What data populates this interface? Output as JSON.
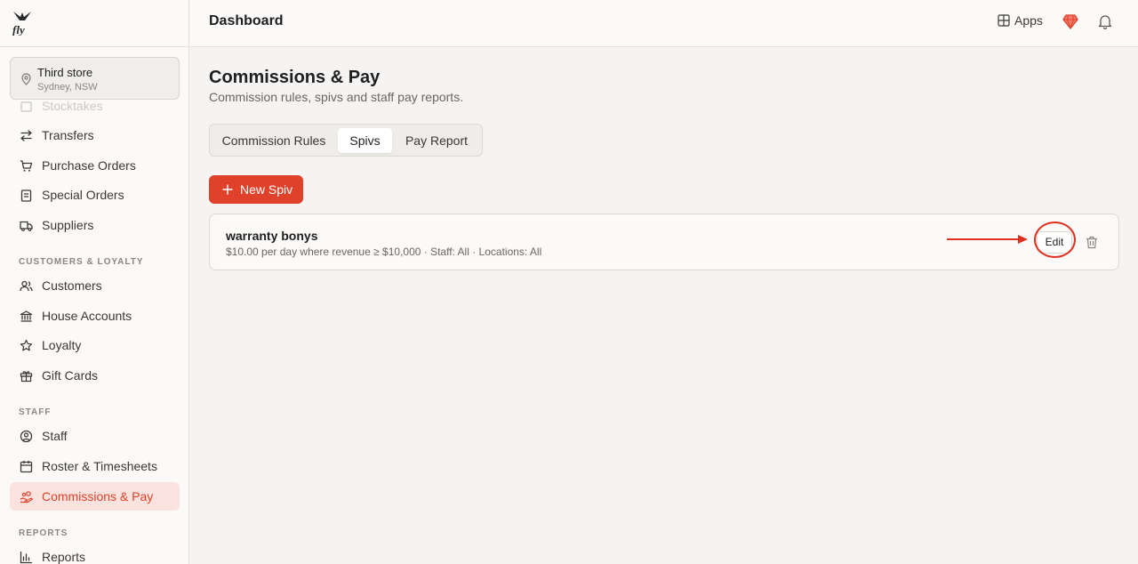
{
  "colors": {
    "accent": "#e0412b",
    "annotation": "#e0301e"
  },
  "store": {
    "name": "Third store",
    "location": "Sydney, NSW"
  },
  "sidebar": {
    "partial_item": "Stocktakes",
    "items_top": [
      {
        "label": "Transfers",
        "icon": "transfer-arrows-icon"
      },
      {
        "label": "Purchase Orders",
        "icon": "cart-icon"
      },
      {
        "label": "Special Orders",
        "icon": "clipboard-icon"
      },
      {
        "label": "Suppliers",
        "icon": "truck-icon"
      }
    ],
    "section_customers": "CUSTOMERS & LOYALTY",
    "items_customers": [
      {
        "label": "Customers",
        "icon": "users-icon"
      },
      {
        "label": "House Accounts",
        "icon": "bank-icon"
      },
      {
        "label": "Loyalty",
        "icon": "star-icon"
      },
      {
        "label": "Gift Cards",
        "icon": "gift-icon"
      }
    ],
    "section_staff": "STAFF",
    "items_staff": [
      {
        "label": "Staff",
        "icon": "user-circle-icon"
      },
      {
        "label": "Roster & Timesheets",
        "icon": "calendar-icon"
      },
      {
        "label": "Commissions & Pay",
        "icon": "hand-coins-icon",
        "active": true
      }
    ],
    "section_reports": "REPORTS",
    "items_reports": [
      {
        "label": "Reports",
        "icon": "bar-chart-icon"
      }
    ]
  },
  "topbar": {
    "title": "Dashboard",
    "apps_label": "Apps"
  },
  "page": {
    "title": "Commissions & Pay",
    "subtitle": "Commission rules, spivs and staff pay reports.",
    "tabs": [
      "Commission Rules",
      "Spivs",
      "Pay Report"
    ],
    "active_tab": "Spivs",
    "new_button": "New Spiv"
  },
  "spivs": [
    {
      "name": "warranty bonys",
      "description": "$10.00 per day where revenue ≥ $10,000 · Staff: All · Locations: All",
      "edit_label": "Edit"
    }
  ]
}
